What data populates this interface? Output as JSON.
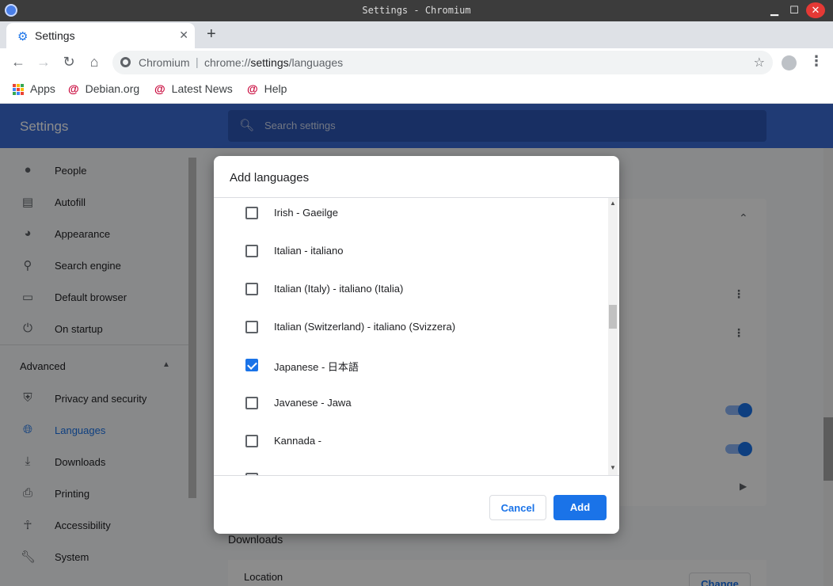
{
  "window": {
    "title": "Settings - Chromium"
  },
  "tab": {
    "label": "Settings",
    "icon": "gear-icon"
  },
  "omnibox": {
    "site": "Chromium",
    "url_prefix": "chrome://",
    "url_host": "settings",
    "url_path": "/languages"
  },
  "bookmarks": [
    {
      "label": "Apps",
      "icon": "apps-grid-icon"
    },
    {
      "label": "Debian.org",
      "icon": "debian-icon"
    },
    {
      "label": "Latest News",
      "icon": "debian-icon"
    },
    {
      "label": "Help",
      "icon": "debian-icon"
    }
  ],
  "settings": {
    "title": "Settings",
    "search_placeholder": "Search settings",
    "sidebar": [
      {
        "label": "People",
        "icon": "person-icon"
      },
      {
        "label": "Autofill",
        "icon": "clipboard-icon"
      },
      {
        "label": "Appearance",
        "icon": "palette-icon"
      },
      {
        "label": "Search engine",
        "icon": "search-icon"
      },
      {
        "label": "Default browser",
        "icon": "browser-icon"
      },
      {
        "label": "On startup",
        "icon": "power-icon"
      }
    ],
    "advanced_label": "Advanced",
    "advanced_items": [
      {
        "label": "Privacy and security",
        "icon": "shield-icon"
      },
      {
        "label": "Languages",
        "icon": "globe-icon",
        "active": true
      },
      {
        "label": "Downloads",
        "icon": "download-icon"
      },
      {
        "label": "Printing",
        "icon": "printer-icon"
      },
      {
        "label": "Accessibility",
        "icon": "accessibility-icon"
      },
      {
        "label": "System",
        "icon": "wrench-icon"
      }
    ],
    "downloads_heading": "Downloads",
    "location_label": "Location",
    "change_label": "Change"
  },
  "dialog": {
    "title": "Add languages",
    "languages": [
      {
        "label": "Irish - Gaeilge",
        "checked": false
      },
      {
        "label": "Italian - italiano",
        "checked": false
      },
      {
        "label": "Italian (Italy) - italiano (Italia)",
        "checked": false
      },
      {
        "label": "Italian (Switzerland) - italiano (Svizzera)",
        "checked": false
      },
      {
        "label": "Japanese - 日本語",
        "checked": true
      },
      {
        "label": "Javanese - Jawa",
        "checked": false
      },
      {
        "label": "Kannada -",
        "checked": false
      },
      {
        "label": "",
        "checked": false
      }
    ],
    "cancel_label": "Cancel",
    "add_label": "Add"
  },
  "colors": {
    "accent": "#1a73e8",
    "header_blue": "#3b6cd4",
    "close_red": "#e53935"
  }
}
